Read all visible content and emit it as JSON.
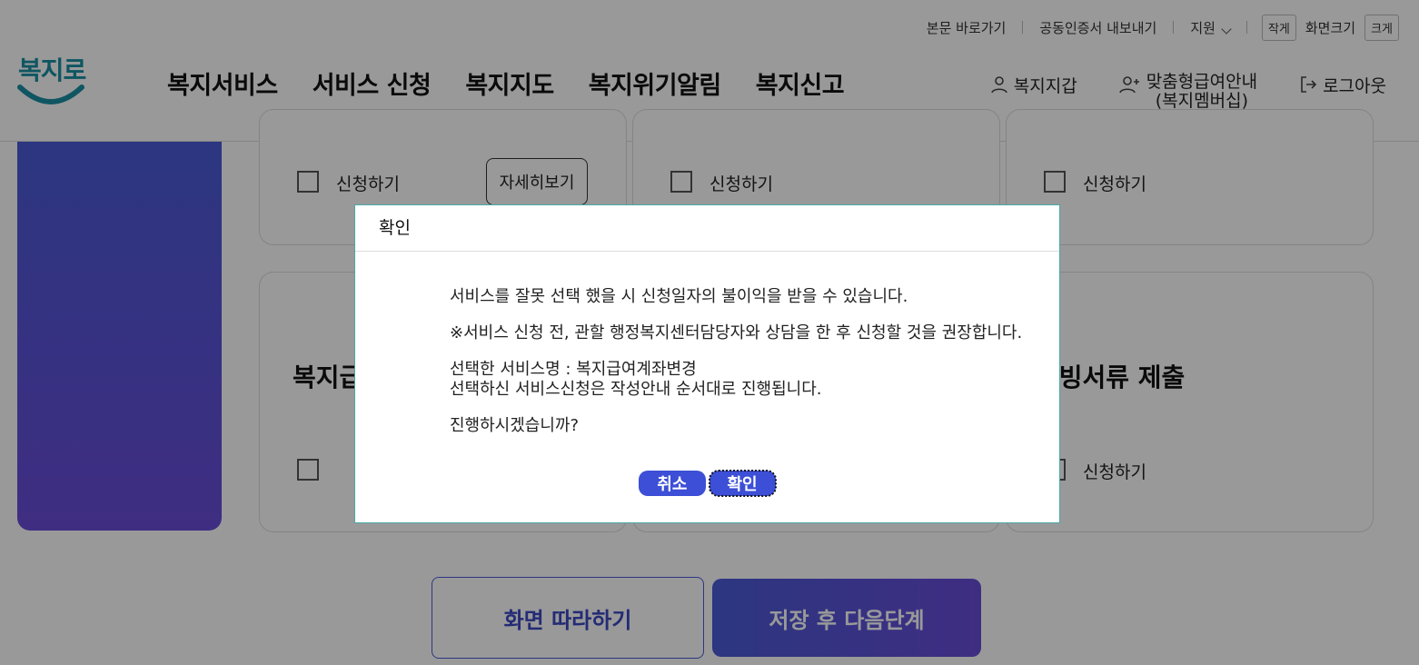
{
  "utility": {
    "skip": "본문 바로가기",
    "cert_export": "공동인증서 내보내기",
    "support": "지원",
    "small": "작게",
    "screen_size": "화면크기",
    "large": "크게"
  },
  "logo": {
    "text": "복지로"
  },
  "gnb": [
    "복지서비스",
    "서비스 신청",
    "복지지도",
    "복지위기알림",
    "복지신고"
  ],
  "header_right": {
    "wallet": "복지지갑",
    "membership_line1": "맞춤형급여안내",
    "membership_line2": "(복지멤버십)",
    "logout": "로그아웃"
  },
  "cards": {
    "apply": "신청하기",
    "detail": "자세히보기",
    "title_left": "복지급",
    "title_right": "증빙서류 제출"
  },
  "buttons": {
    "follow": "화면 따라하기",
    "save_next": "저장 후 다음단계"
  },
  "modal": {
    "title": "확인",
    "line1": "서비스를 잘못 선택 했을 시 신청일자의 불이익을 받을 수 있습니다.",
    "line2": "※서비스 신청 전, 관할 행정복지센터담당자와 상담을 한 후 신청할 것을 권장합니다.",
    "line3": "선택한 서비스명 : 복지급여계좌변경",
    "line4": "선택하신 서비스신청은 작성안내 순서대로 진행됩니다.",
    "line5": "진행하시겠습니까?",
    "cancel": "취소",
    "confirm": "확인"
  },
  "colors": {
    "primary": "#4a5bd8",
    "brand_teal": "#1a8fa3"
  }
}
